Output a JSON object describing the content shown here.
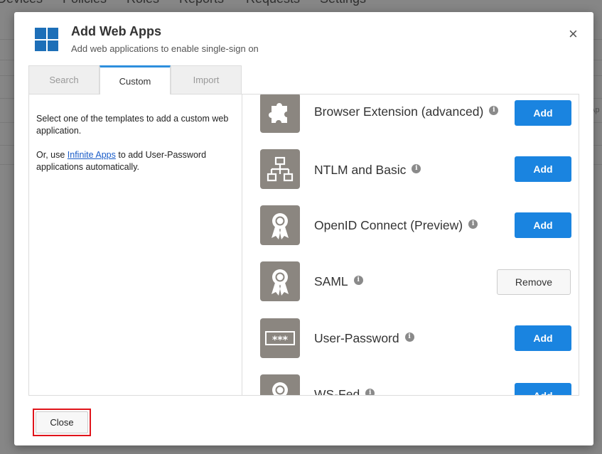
{
  "background": {
    "nav": [
      "Devices",
      "Policies",
      "Roles",
      "Reports",
      "Requests",
      "Settings"
    ],
    "side_text": "Ap"
  },
  "modal": {
    "title": "Add Web Apps",
    "subtitle": "Add web applications to enable single-sign on",
    "close_icon": "×",
    "tabs": [
      {
        "label": "Search",
        "active": false
      },
      {
        "label": "Custom",
        "active": true
      },
      {
        "label": "Import",
        "active": false
      }
    ],
    "description": {
      "line1": "Select one of the templates to add a custom web application.",
      "prefix": "Or, use ",
      "link": "Infinite Apps",
      "suffix": " to add User-Password applications automatically."
    },
    "apps": [
      {
        "name": "Browser Extension (advanced)",
        "icon": "puzzle-icon",
        "action": "Add"
      },
      {
        "name": "NTLM and Basic",
        "icon": "network-icon",
        "action": "Add"
      },
      {
        "name": "OpenID Connect (Preview)",
        "icon": "certificate-icon",
        "action": "Add"
      },
      {
        "name": "SAML",
        "icon": "certificate-icon",
        "action": "Remove"
      },
      {
        "name": "User-Password",
        "icon": "password-icon",
        "action": "Add"
      },
      {
        "name": "WS-Fed",
        "icon": "certificate-icon",
        "action": "Add"
      }
    ],
    "info_glyph": "i",
    "password_mask": "***",
    "close_button": "Close"
  },
  "colors": {
    "primary": "#1a84e0",
    "tab_accent": "#2d8fdd",
    "icon_bg": "#8b8680",
    "highlight": "#e0141b"
  }
}
